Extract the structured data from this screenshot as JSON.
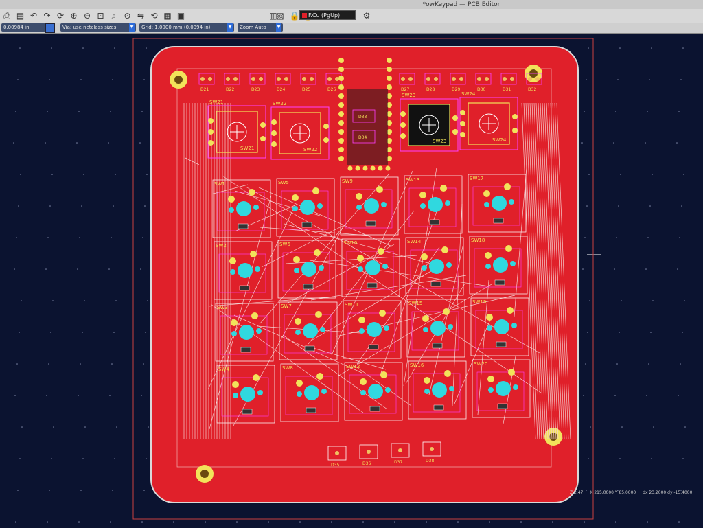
{
  "window": {
    "title": "*owKeypad — PCB Editor"
  },
  "toolbar": {
    "icons": [
      "print-icon",
      "plot-icon",
      "undo-icon",
      "redo-icon",
      "refresh-icon",
      "zoom-in-icon",
      "zoom-out-icon",
      "zoom-fit-icon",
      "zoom-objects-icon",
      "zoom-selection-icon",
      "flip-icon",
      "rotate-icon",
      "grid-icon",
      "group-icon",
      "lock-icon",
      "unlock-icon",
      "netlist-icon",
      "footprint-icon",
      "layer-pair-icon",
      "scripting-icon"
    ],
    "layer": "F.Cu (PgUp)",
    "layer_color": "#e0202a"
  },
  "options": {
    "track_width": "0.00984 in",
    "via_size": "Via: use netclass sizes",
    "grid": "Grid: 1.0000 mm (0.0394 in)",
    "zoom": "Zoom Auto"
  },
  "board": {
    "copper_color": "#e0202a",
    "silkscreen_color": "#f2e35a",
    "pad_color": "#30d8df",
    "courtyard_color": "#ff40ff",
    "edge_color": "#d9d9d9",
    "page_border_color": "#c84040",
    "switches": [
      [
        "SW1",
        "SW5",
        "SW9",
        "SW13",
        "SW17"
      ],
      [
        "SW2",
        "SW6",
        "SW10",
        "SW14",
        "SW18"
      ],
      [
        "SW3",
        "SW7",
        "SW11",
        "SW15",
        "SW19"
      ],
      [
        "SW4",
        "SW8",
        "SW12",
        "SW16",
        "SW20"
      ]
    ],
    "encoders": [
      "SW21",
      "SW22",
      "SW23",
      "SW24"
    ],
    "top_leds": [
      "D21",
      "D22",
      "D23",
      "D24",
      "D25",
      "D26",
      "D27",
      "D28",
      "D29",
      "D30",
      "D31",
      "D32"
    ],
    "mid_leds": [
      "D33",
      "D34"
    ],
    "bottom_leds": [
      "D35",
      "D36",
      "D37",
      "D38"
    ]
  },
  "status": {
    "z": "Z 2.47",
    "xy": "X 215.0000  Y 85.0000",
    "dxy": "dx 23.2000  dy -15.4000"
  }
}
